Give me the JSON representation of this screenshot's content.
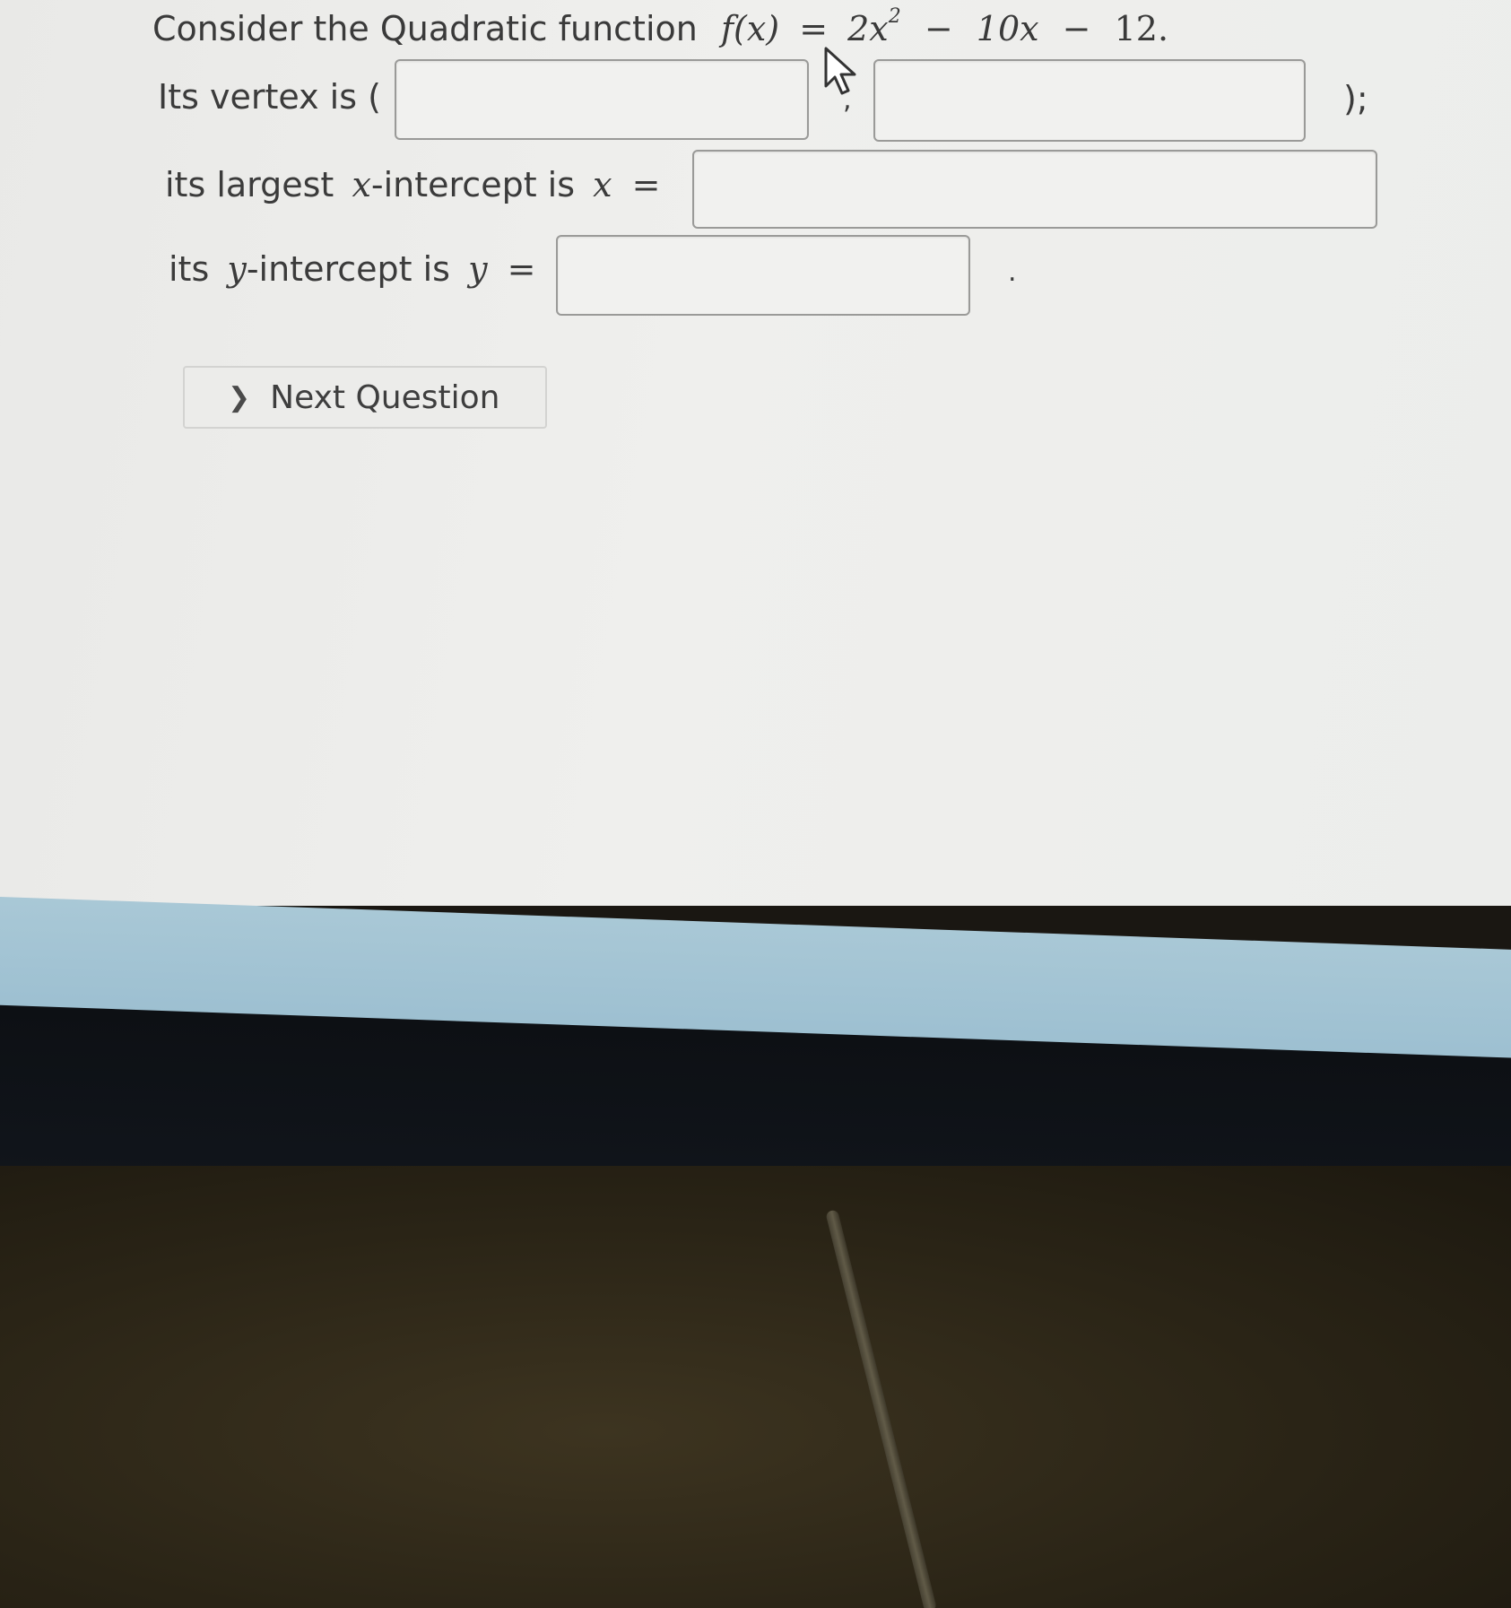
{
  "question": {
    "intro": "Consider the Quadratic function",
    "function_lhs": "f(x)",
    "equals": "=",
    "term1": "2x",
    "exponent": "2",
    "minus1": "−",
    "term2": "10x",
    "minus2": "−",
    "term3": "12."
  },
  "vertex": {
    "prefix": "Its vertex is (",
    "separator": ",",
    "suffix": ");",
    "x_value": "",
    "y_value": ""
  },
  "x_intercept": {
    "prefix_a": "its largest",
    "variable": "x",
    "prefix_b": "-intercept is",
    "rhs_var": "x",
    "equals": "=",
    "value": ""
  },
  "y_intercept": {
    "prefix_a": "its",
    "variable": "y",
    "prefix_b": "-intercept is",
    "rhs_var": "y",
    "equals": "=",
    "value": "",
    "suffix": "."
  },
  "next_button": {
    "label": "Next Question",
    "icon": "chevron-right-icon"
  },
  "colors": {
    "screen_bg": "#ececea",
    "text": "#3b3b3b",
    "input_border": "#9a9a98",
    "taskbar": "#a4c4d4"
  }
}
